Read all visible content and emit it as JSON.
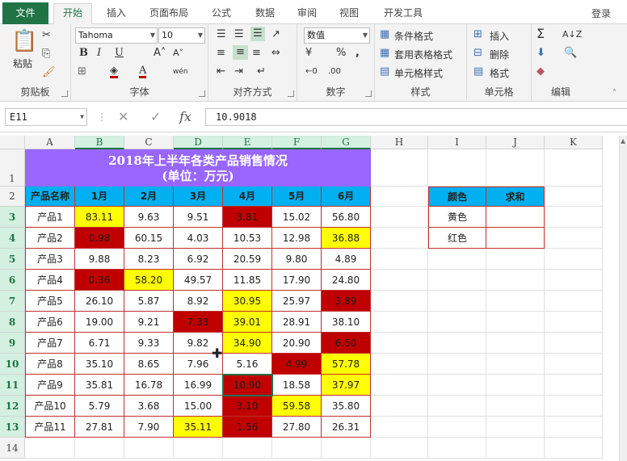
{
  "ribbon_tabs": [
    "文件",
    "开始",
    "插入",
    "页面布局",
    "公式",
    "数据",
    "审阅",
    "视图",
    "开发工具"
  ],
  "login": "登录",
  "clipboard": {
    "paste": "粘贴",
    "group": "剪贴板"
  },
  "font": {
    "name": "Tahoma",
    "size": "10",
    "group": "字体",
    "bold": "B",
    "italic": "I",
    "underline": "U"
  },
  "align": {
    "group": "对齐方式"
  },
  "number": {
    "format": "数值",
    "group": "数字"
  },
  "styles": {
    "cond": "条件格式",
    "table": "套用表格格式",
    "cell": "单元格样式",
    "group": "样式"
  },
  "cells": {
    "insert": "插入",
    "delete": "删除",
    "format": "格式",
    "group": "单元格"
  },
  "edit": {
    "group": "编辑"
  },
  "formula_bar": {
    "name_box": "E11",
    "fx": "fx",
    "value": "10.9018"
  },
  "columns": [
    "A",
    "B",
    "C",
    "D",
    "E",
    "F",
    "G",
    "H",
    "I",
    "J",
    "K"
  ],
  "rows": [
    "1",
    "2",
    "3",
    "4",
    "5",
    "6",
    "7",
    "8",
    "9",
    "10",
    "11",
    "12",
    "13",
    "14"
  ],
  "sheet": {
    "title_line1": "2018年上半年各类产品销售情况",
    "title_line2": "(单位：万元)",
    "headers": [
      "产品名称",
      "1月",
      "2月",
      "3月",
      "4月",
      "5月",
      "6月"
    ],
    "data": [
      [
        "产品1",
        "83.11",
        "9.63",
        "9.51",
        "3.81",
        "15.02",
        "56.80"
      ],
      [
        "产品2",
        "0.98",
        "60.15",
        "4.03",
        "10.53",
        "12.98",
        "36.88"
      ],
      [
        "产品3",
        "9.88",
        "8.23",
        "6.92",
        "20.59",
        "9.80",
        "4.89"
      ],
      [
        "产品4",
        "0.36",
        "58.20",
        "49.57",
        "11.85",
        "17.90",
        "24.80"
      ],
      [
        "产品5",
        "26.10",
        "5.87",
        "8.92",
        "30.95",
        "25.97",
        "3.89"
      ],
      [
        "产品6",
        "19.00",
        "9.21",
        "7.33",
        "39.01",
        "28.91",
        "38.10"
      ],
      [
        "产品7",
        "6.71",
        "9.33",
        "9.82",
        "34.90",
        "20.90",
        "6.50"
      ],
      [
        "产品8",
        "35.10",
        "8.65",
        "7.96",
        "5.16",
        "4.99",
        "57.78"
      ],
      [
        "产品9",
        "35.81",
        "16.78",
        "16.99",
        "10.90",
        "18.58",
        "37.97"
      ],
      [
        "产品10",
        "5.79",
        "3.68",
        "15.00",
        "3.10",
        "59.58",
        "35.80"
      ],
      [
        "产品11",
        "27.81",
        "7.90",
        "35.11",
        "1.56",
        "27.80",
        "26.31"
      ]
    ],
    "fills": [
      [
        "",
        "y",
        "",
        "",
        "r",
        "",
        ""
      ],
      [
        "",
        "r",
        "",
        "",
        "",
        "",
        "y"
      ],
      [
        "",
        "",
        "",
        "",
        "",
        "",
        ""
      ],
      [
        "",
        "r",
        "y",
        "",
        "",
        "",
        ""
      ],
      [
        "",
        "",
        "",
        "",
        "y",
        "",
        "r"
      ],
      [
        "",
        "",
        "",
        "r",
        "y",
        "",
        ""
      ],
      [
        "",
        "",
        "",
        "",
        "y",
        "",
        "r"
      ],
      [
        "",
        "",
        "",
        "",
        "",
        "r",
        "y"
      ],
      [
        "",
        "",
        "",
        "",
        "r",
        "",
        "y"
      ],
      [
        "",
        "",
        "",
        "",
        "r",
        "y",
        ""
      ],
      [
        "",
        "",
        "",
        "y",
        "r",
        "",
        ""
      ]
    ],
    "summary_headers": [
      "颜色",
      "求和"
    ],
    "summary_rows": [
      [
        "黄色",
        ""
      ],
      [
        "红色",
        ""
      ]
    ]
  },
  "colors": {
    "green": "#217346",
    "yellow": "#ffff00",
    "red": "#c00000",
    "blue": "#00b0f0",
    "purple": "#9966ff"
  }
}
